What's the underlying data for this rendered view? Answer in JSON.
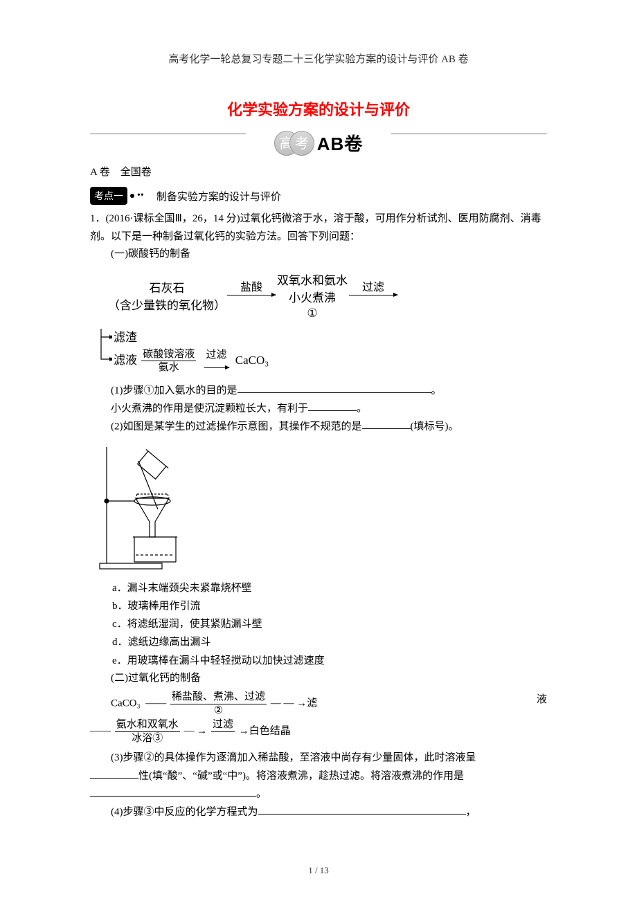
{
  "header": "高考化学一轮总复习专题二十三化学实验方案的设计与评价 AB 卷",
  "title": "化学实验方案的设计与评价",
  "badge": {
    "c1": "高",
    "c2": "考",
    "ab": "AB卷"
  },
  "sectionA": "A 卷　全国卷",
  "kaodian": {
    "badge": "考点一",
    "text": "制备实验方案的设计与评价"
  },
  "q1": {
    "stem": "1．(2016·课标全国Ⅲ，26，14 分)过氧化钙微溶于水，溶于酸，可用作分析试剂、医用防腐剂、消毒剂。以下是一种制备过氧化钙的实验方法。回答下列问题：",
    "part1_heading": "(一)碳酸钙的制备",
    "flow1": {
      "start_top": "石灰石",
      "start_bot": "（含少量铁的氧化物）",
      "arr1_top": "盐酸",
      "mid_top": "双氧水和氨水",
      "mid_bot": "小火煮沸",
      "arr2_top": "过滤",
      "circ": "①"
    },
    "branch": {
      "r1": "滤渣",
      "r2_a": "滤液",
      "r2_frac_t": "碳酸铵溶液",
      "r2_frac_b": "氨水",
      "r2_arr": "过滤",
      "r2_end": "CaCO₃"
    },
    "p1a": "(1)步骤①加入氨水的目的是",
    "p1a_end": "。",
    "p1b": "小火煮沸的作用是使沉淀颗粒长大，有利于",
    "p1b_end": "。",
    "p2": "(2)如图是某学生的过滤操作示意图，其操作不规范的是",
    "p2_end": "(填标号)。",
    "opts": {
      "a": "a．漏斗末端颈尖未紧靠烧杯壁",
      "b": "b．玻璃棒用作引流",
      "c": "c．将滤纸湿润，使其紧贴漏斗壁",
      "d": "d．滤纸边缘高出漏斗",
      "e": "e．用玻璃棒在漏斗中轻轻搅动以加快过滤速度"
    },
    "part2_heading": "(二)过氧化钙的制备",
    "flow2": {
      "l1_a": "CaCO₃",
      "l1_frac_t": "稀盐酸、煮沸、过滤",
      "l1_frac_b": "②",
      "l1_mid": "— →滤",
      "l1_right": "液",
      "l2_frac_t": "氨水和双氧水",
      "l2_frac_b": "冰浴③",
      "l2_mid": "— →",
      "l2_arr": "过滤",
      "l2_end": "→白色结晶"
    },
    "p3a": "(3)步骤②的具体操作为逐滴加入稀盐酸，至溶液中尚存有少量固体，此时溶液呈",
    "p3b": "性(填“酸”、“碱”或“中”)。将溶液煮沸，趁热过滤。将溶液煮沸的作用是",
    "p3c": "。",
    "p4": "(4)步骤③中反应的化学方程式为",
    "p4_end": "，"
  },
  "footer": "1 / 13"
}
